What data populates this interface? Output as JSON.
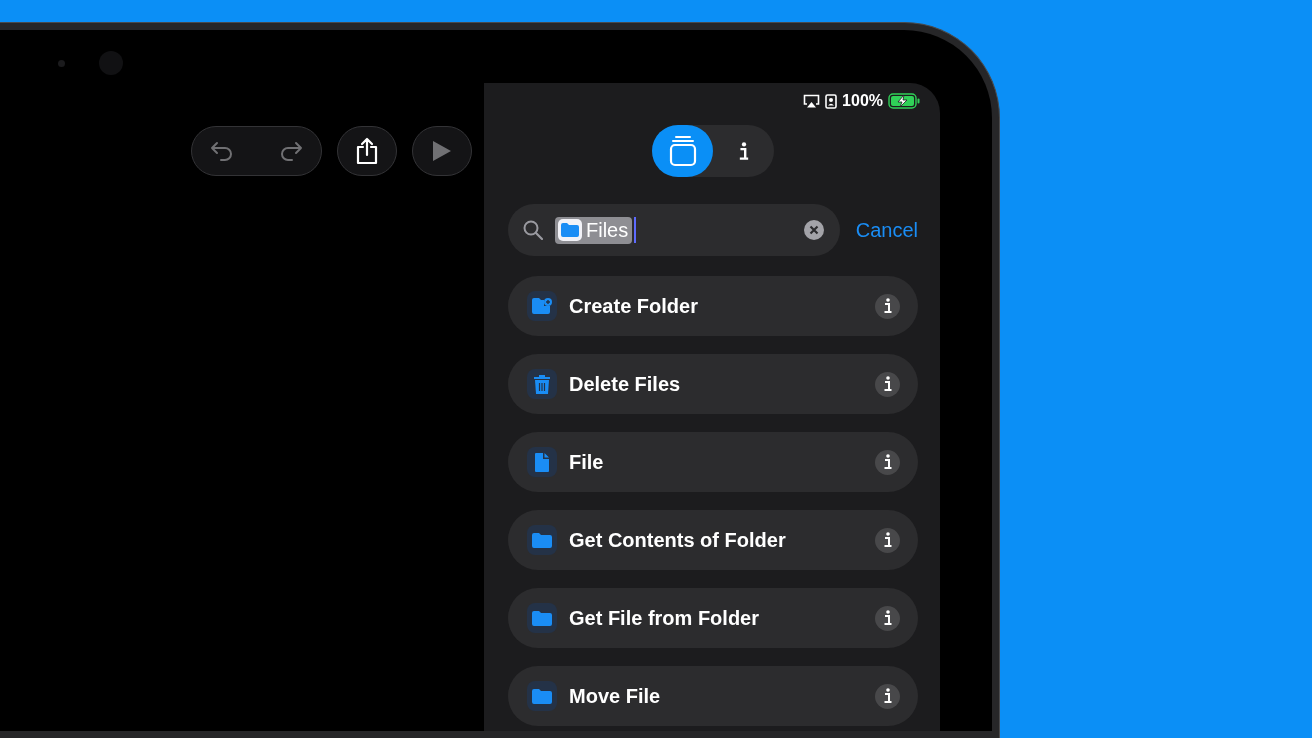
{
  "toolbar": {
    "buttons": [
      {
        "kind": "undo-redo",
        "disabled": true
      },
      {
        "kind": "share",
        "disabled": false
      },
      {
        "kind": "play",
        "disabled": true
      }
    ]
  },
  "status_bar": {
    "battery": "100%",
    "charging": true
  },
  "segments": [
    {
      "kind": "actions",
      "selected": true
    },
    {
      "kind": "info",
      "selected": false
    }
  ],
  "search": {
    "token": {
      "label": "Files",
      "selected": true
    },
    "cancel": "Cancel"
  },
  "actions": [
    {
      "label": "Create Folder",
      "kind": "folder-add"
    },
    {
      "label": "Delete Files",
      "kind": "trash"
    },
    {
      "label": "File",
      "kind": "file"
    },
    {
      "label": "Get Contents of Folder",
      "kind": "folder"
    },
    {
      "label": "Get File from Folder",
      "kind": "folder"
    },
    {
      "label": "Move File",
      "kind": "folder"
    }
  ]
}
